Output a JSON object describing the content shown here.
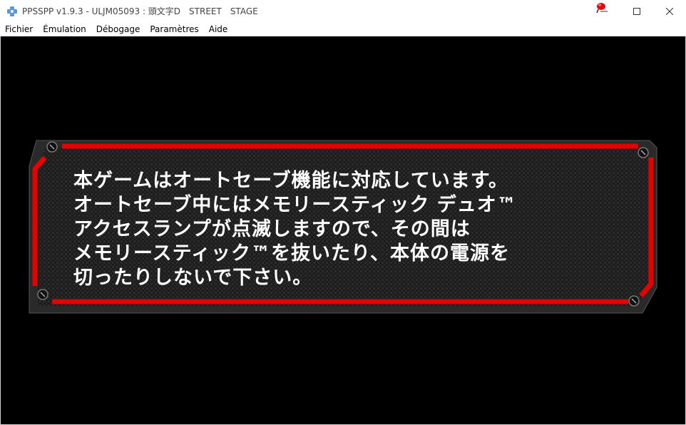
{
  "window": {
    "title": "PPSSPP v1.9.3 - ULJM05093 : 頭文字D　STREET　STAGE"
  },
  "icons": {
    "app": "ppsspp-logo-icon",
    "tray": "red-notification-icon",
    "minimize": "minimize-icon",
    "maximize": "maximize-icon",
    "close": "close-icon",
    "screws": "screw-icon"
  },
  "menu": {
    "items": [
      "Fichier",
      "Émulation",
      "Débogage",
      "Paramètres",
      "Aide"
    ]
  },
  "game": {
    "message_lines": [
      "本ゲームはオートセーブ機能に対応しています。",
      "オートセーブ中にはメモリースティック デュオ™",
      "アクセスランプが点滅しますので、その間は",
      "メモリースティック™を抜いたり、本体の電源を",
      "切ったりしないで下さい。"
    ]
  },
  "colors": {
    "accent_red": "#e60000",
    "panel_dark": "#1e1e1e",
    "background": "#000000",
    "text": "#ffffff"
  }
}
